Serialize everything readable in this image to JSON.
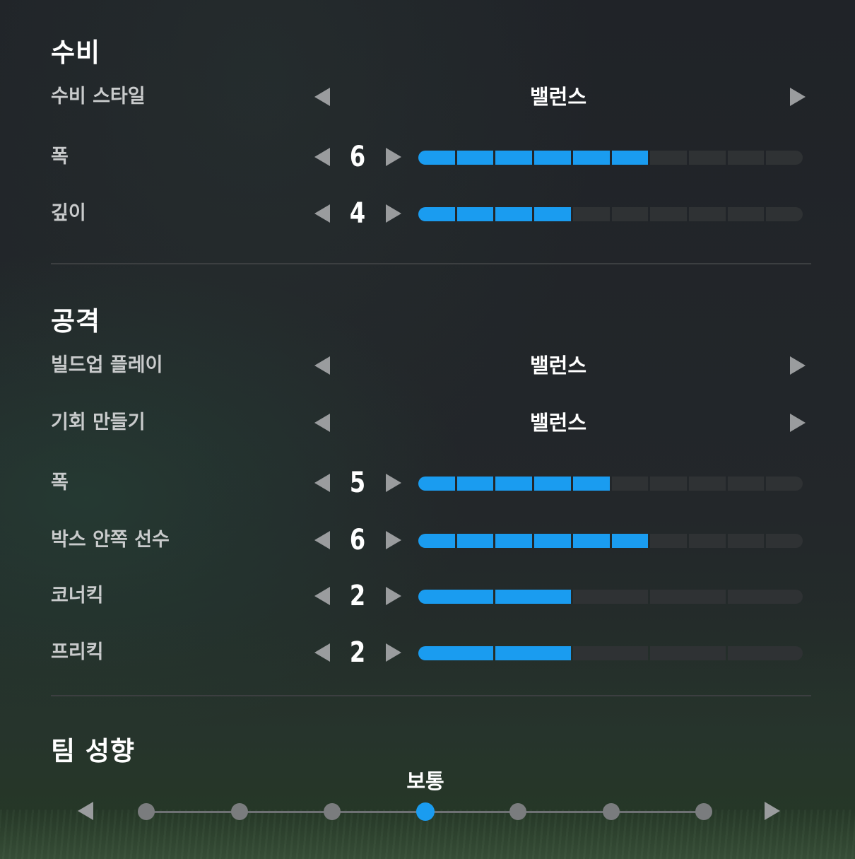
{
  "defense": {
    "title": "수비",
    "style": {
      "label": "수비 스타일",
      "value": "밸런스"
    },
    "width": {
      "label": "폭",
      "value": "6",
      "level": 6,
      "max": 10
    },
    "depth": {
      "label": "깊이",
      "value": "4",
      "level": 4,
      "max": 10
    }
  },
  "attack": {
    "title": "공격",
    "buildup": {
      "label": "빌드업 플레이",
      "value": "밸런스"
    },
    "chance": {
      "label": "기회 만들기",
      "value": "밸런스"
    },
    "width": {
      "label": "폭",
      "value": "5",
      "level": 5,
      "max": 10
    },
    "box_players": {
      "label": "박스 안쪽 선수",
      "value": "6",
      "level": 6,
      "max": 10
    },
    "corner": {
      "label": "코너킥",
      "value": "2",
      "level": 2,
      "max": 5
    },
    "freekick": {
      "label": "프리킥",
      "value": "2",
      "level": 2,
      "max": 5
    }
  },
  "tendency": {
    "title": "팀 성향",
    "selected_label": "보통",
    "selected_index": 3,
    "step_count": 7
  },
  "colors": {
    "accent": "#1a9cf0",
    "bar_empty": "#2f3234",
    "arrow": "#9a9c9e"
  }
}
